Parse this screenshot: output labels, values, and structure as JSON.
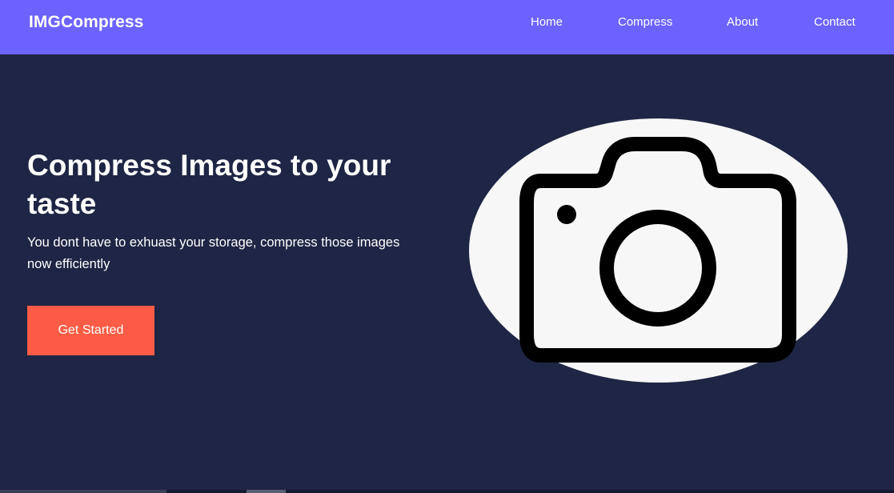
{
  "navbar": {
    "brand": "IMGCompress",
    "links": [
      {
        "label": "Home"
      },
      {
        "label": "Compress"
      },
      {
        "label": "About"
      },
      {
        "label": "Contact"
      }
    ],
    "background": "#6c63ff"
  },
  "hero": {
    "title": "Compress Images to your taste",
    "subtitle": "You dont have to exhuast your storage, compress those images now efficiently",
    "cta_label": "Get Started",
    "background": "#1f2544",
    "cta_color": "#fc5c45",
    "illustration_icon": "camera-icon"
  }
}
